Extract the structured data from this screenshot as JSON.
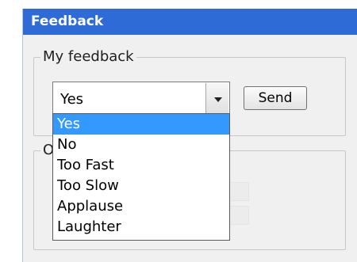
{
  "window": {
    "title": "Feedback"
  },
  "my_feedback": {
    "legend": "My feedback",
    "combo_value": "Yes",
    "send_label": "Send",
    "options": [
      "Yes",
      "No",
      "Too Fast",
      "Too Slow",
      "Applause",
      "Laughter"
    ],
    "selected_index": 0
  },
  "second_group": {
    "legend_fragment": "O"
  },
  "colors": {
    "titlebar": "#2f6bd6",
    "selection": "#3399ff"
  }
}
